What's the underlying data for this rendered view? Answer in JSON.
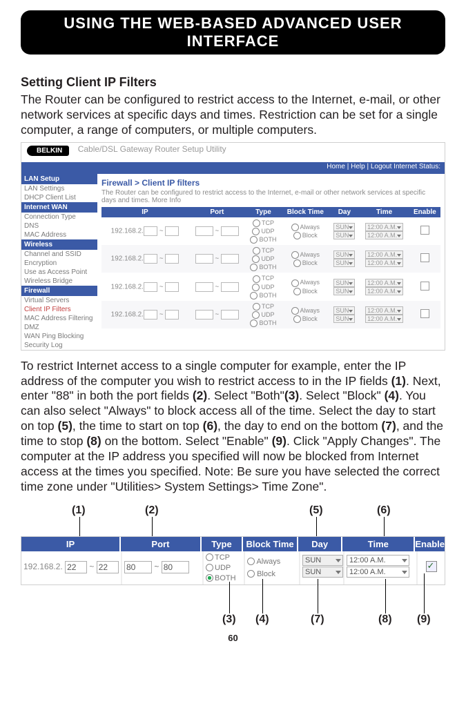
{
  "banner": "USING THE WEB-BASED ADVANCED USER INTERFACE",
  "section_title": "Setting Client IP Filters",
  "intro": "The Router can be configured to restrict access to the Internet, e-mail, or other network services at specific days and times. Restriction can be set for a single computer, a range of computers, or multiple computers.",
  "shot1": {
    "brand": "BELKIN",
    "util_title": "Cable/DSL Gateway Router Setup Utility",
    "topnav": "Home | Help | Logout    Internet Status:",
    "sidebar": {
      "groups": [
        {
          "hdr": "LAN Setup",
          "items": [
            "LAN Settings",
            "DHCP Client List"
          ]
        },
        {
          "hdr": "Internet WAN",
          "items": [
            "Connection Type",
            "DNS",
            "MAC Address"
          ]
        },
        {
          "hdr": "Wireless",
          "items": [
            "Channel and SSID",
            "Encryption",
            "Use as Access Point",
            "Wireless Bridge"
          ]
        },
        {
          "hdr": "Firewall",
          "items": [
            "Virtual Servers",
            "Client IP Filters",
            "MAC Address Filtering",
            "DMZ",
            "WAN Ping Blocking",
            "Security Log"
          ],
          "activeIndex": 1
        }
      ]
    },
    "crumb": "Firewall > Client IP filters",
    "desc": "The Router can be configured to restrict access to the Internet, e-mail or other network services at specific days and times. More Info",
    "headers": [
      "IP",
      "Port",
      "Type",
      "Block Time",
      "Day",
      "Time",
      "Enable"
    ],
    "ip_prefix": "192.168.2.",
    "type_opts": [
      "TCP",
      "UDP",
      "BOTH"
    ],
    "bt_opts": [
      "Always",
      "Block"
    ],
    "day": "SUN",
    "time": "12:00 A.M."
  },
  "body2_parts": [
    "To restrict Internet access to a single computer for example, enter the IP address of the computer you wish to restrict access to in the IP fields ",
    ". Next, enter \"88\" in both the port fields ",
    ". Select \"Both\"",
    ". Select \"Block\" ",
    ". You can also select \"Always\" to block access all of the time. Select the day to start on top ",
    ", the time to start on top ",
    ", the day to end on the bottom ",
    ", and the time to stop ",
    " on the bottom. Select \"Enable\" ",
    ". Click \"Apply Changes\". The computer at the IP address you specified will now be blocked from Internet access at the times you specified. Note: Be sure you have selected the correct time zone under \"Utilities> System Settings> Time Zone\"."
  ],
  "bold_refs": [
    "(1)",
    "(2)",
    "(3)",
    "(4)",
    "(5)",
    "(6)",
    "(7)",
    "(8)",
    "(9)"
  ],
  "callout_labels": {
    "c1": "(1)",
    "c2": "(2)",
    "c3": "(3)",
    "c4": "(4)",
    "c5": "(5)",
    "c6": "(6)",
    "c7": "(7)",
    "c8": "(8)",
    "c9": "(9)"
  },
  "shot2": {
    "headers": {
      "ip": "IP",
      "port": "Port",
      "type": "Type",
      "bt": "Block Time",
      "day": "Day",
      "time": "Time",
      "en": "Enable"
    },
    "ip_prefix": "192.168.2.",
    "ip_a": "22",
    "ip_b": "22",
    "port_a": "80",
    "port_b": "80",
    "type": [
      "TCP",
      "UDP",
      "BOTH"
    ],
    "bt": [
      "Always",
      "Block"
    ],
    "day1": "SUN",
    "day2": "SUN",
    "time1": "12:00 A.M.",
    "time2": "12:00 A.M."
  },
  "page_number": "60"
}
